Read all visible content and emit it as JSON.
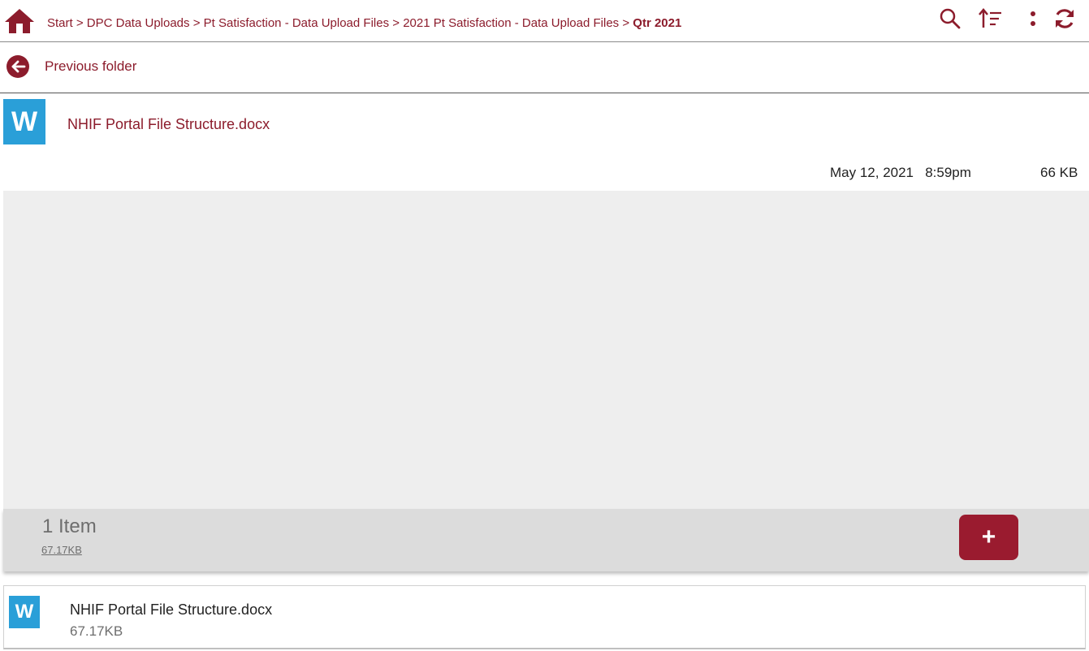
{
  "breadcrumb": {
    "items": [
      "Start",
      "DPC Data Uploads",
      "Pt Satisfaction - Data Upload Files",
      "2021 Pt Satisfaction - Data Upload Files"
    ],
    "separator": ">",
    "current": "Qtr 2021"
  },
  "toolbar": {
    "icons": [
      "search-icon",
      "sort-icon",
      "more-vertical-icon",
      "refresh-icon"
    ]
  },
  "nav": {
    "previous_label": "Previous folder"
  },
  "files": [
    {
      "icon_letter": "W",
      "name": "NHIF Portal File Structure.docx",
      "date": "May 12, 2021",
      "time": "8:59pm",
      "size": "66 KB"
    }
  ],
  "summary": {
    "count_label": "1 Item",
    "total_size": "67.17KB",
    "add_label": "+"
  },
  "upload": {
    "icon_letter": "W",
    "name": "NHIF Portal File Structure.docx",
    "size": "67.17KB"
  },
  "colors": {
    "accent": "#8c1c2c",
    "word_blue": "#2a9fd8",
    "empty_bg": "#eeeeee",
    "summary_bg": "#dcdcdc"
  }
}
